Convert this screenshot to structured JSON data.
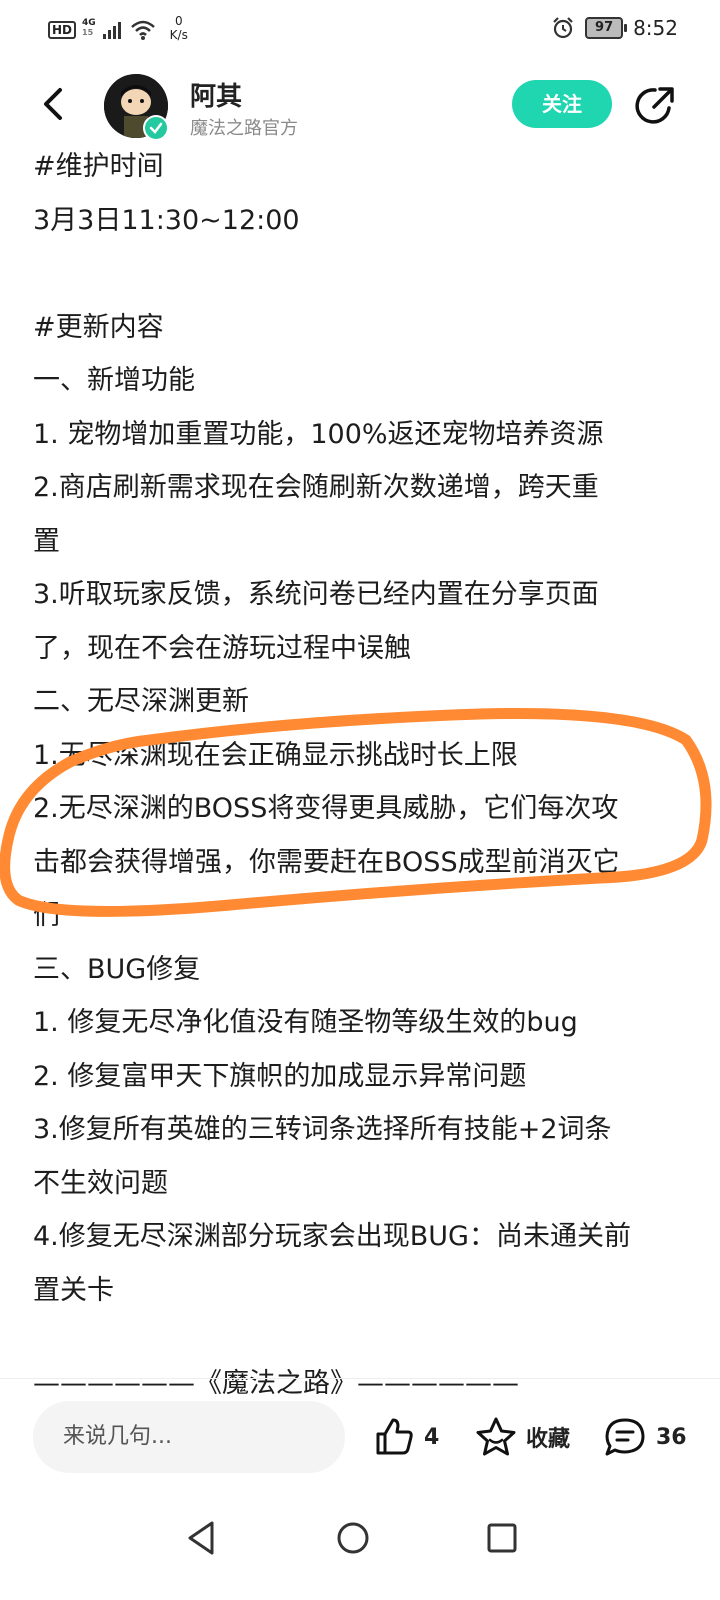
{
  "status_bar": {
    "hd": "HD",
    "network_top": "4G",
    "network_bottom": "15",
    "speed_value": "0",
    "speed_unit": "K/s",
    "battery": "97",
    "time": "8:52"
  },
  "header": {
    "author_name": "阿其",
    "author_subtitle": "魔法之路官方",
    "follow_label": "关注"
  },
  "post": {
    "lines": [
      "#维护时间",
      "3月3日11:30~12:00",
      "",
      "#更新内容",
      "一、新增功能",
      "1. 宠物增加重置功能，100%返还宠物培养资源",
      "2.商店刷新需求现在会随刷新次数递增，跨天重",
      "置",
      "3.听取玩家反馈，系统问卷已经内置在分享页面",
      "了，现在不会在游玩过程中误触",
      "二、无尽深渊更新",
      "1.无尽深渊现在会正确显示挑战时长上限",
      "2.无尽深渊的BOSS将变得更具威胁，它们每次攻",
      "击都会获得增强，你需要赶在BOSS成型前消灭它",
      "们",
      "三、BUG修复",
      "1. 修复无尽净化值没有随圣物等级生效的bug",
      "2. 修复富甲天下旗帜的加成显示异常问题",
      "3.修复所有英雄的三转词条选择所有技能+2词条",
      "不生效问题",
      "4.修复无尽深渊部分玩家会出现BUG：尚未通关前",
      "置关卡"
    ],
    "footer_divider": "——————《魔法之路》——————"
  },
  "bottom_bar": {
    "comment_placeholder": "来说几句...",
    "like_count": "4",
    "favorite_label": "收藏",
    "comment_count": "36"
  },
  "colors": {
    "accent": "#1fd6b0",
    "highlight_stroke": "#ff8a33"
  },
  "icons": [
    "back-arrow-icon",
    "verified-icon",
    "share-icon",
    "thumbs-up-icon",
    "star-icon",
    "comment-icon",
    "nav-back-icon",
    "nav-home-icon",
    "nav-recents-icon"
  ]
}
